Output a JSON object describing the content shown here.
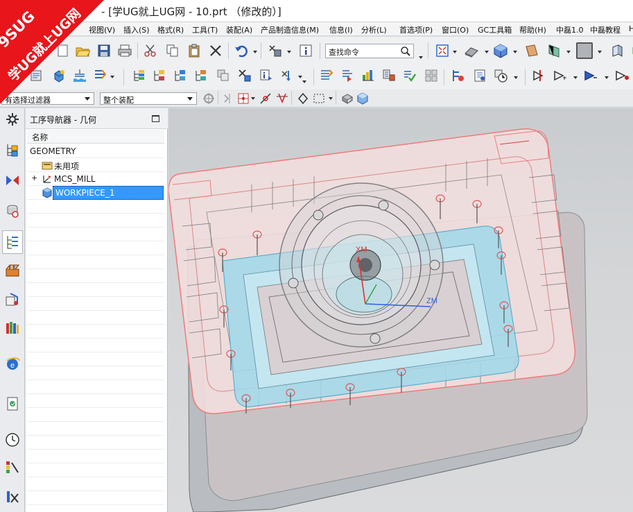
{
  "window": {
    "title": "- [学UG就上UG网 - 10.prt （修改的）]"
  },
  "watermark": {
    "line1": "9SUG",
    "line2": "学UG就上UG网"
  },
  "menu": {
    "items": [
      {
        "label": "视图(V)"
      },
      {
        "label": "插入(S)"
      },
      {
        "label": "格式(R)"
      },
      {
        "label": "工具(T)"
      },
      {
        "label": "装配(A)"
      },
      {
        "label": "产品制造信息(M)"
      },
      {
        "label": "信息(I)"
      },
      {
        "label": "分析(L)"
      },
      {
        "label": "首选项(P)"
      },
      {
        "label": "窗口(O)"
      },
      {
        "label": "GC工具箱"
      },
      {
        "label": "帮助(H)"
      },
      {
        "label": "中磊1.0"
      },
      {
        "label": "中磊教程"
      },
      {
        "label": "H"
      }
    ]
  },
  "toolbar": {
    "search_label": "查找命令",
    "selection_filter": "有选择过滤器",
    "assembly_scope": "整个装配"
  },
  "navigator": {
    "title": "工序导航器 - 几何",
    "column_name": "名称",
    "nodes": [
      {
        "label": "GEOMETRY"
      },
      {
        "label": "未用项"
      },
      {
        "label": "MCS_MILL"
      },
      {
        "label": "WORKPIECE_1"
      }
    ]
  },
  "viewport": {
    "axes": {
      "x_label": "XM",
      "z_label": "ZM"
    }
  },
  "colors": {
    "mold_face": "#f2dede",
    "mold_edge": "#ef7a7a",
    "cavity": "#9fd8ea",
    "selected_row": "#3399ff",
    "axis_x": "#e03030",
    "axis_z": "#3060e0"
  }
}
